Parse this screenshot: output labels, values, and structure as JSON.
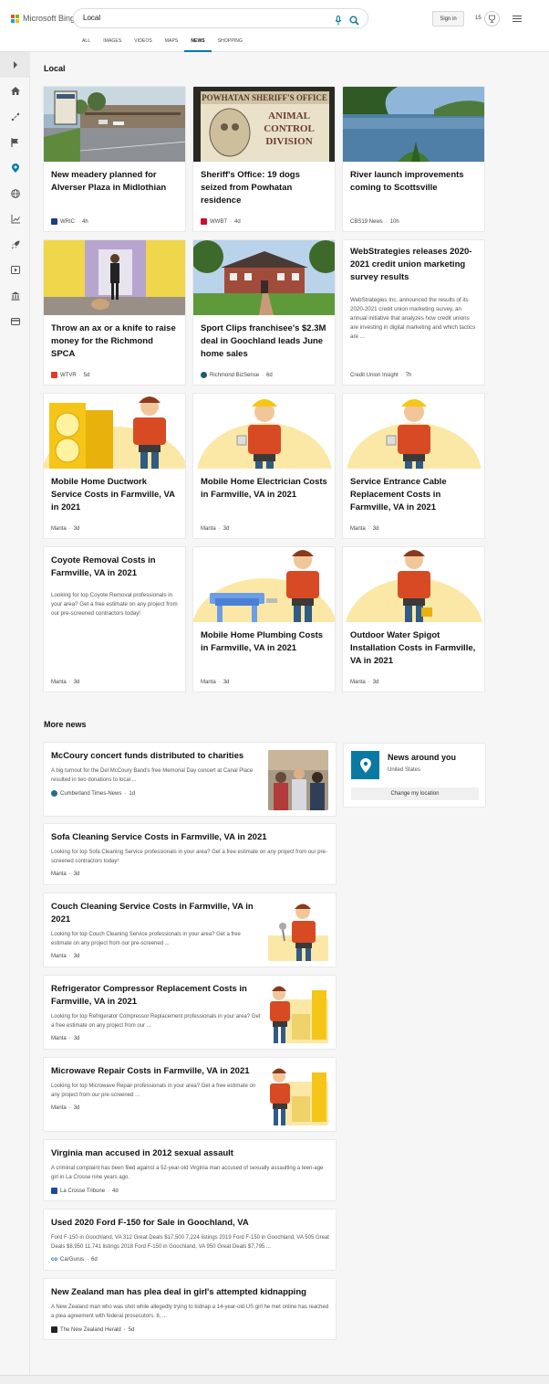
{
  "header": {
    "brand": "Microsoft Bing",
    "query": "Local",
    "sign_in": "Sign in",
    "rewards_count": "15",
    "tabs": [
      {
        "label": "ALL",
        "active": false
      },
      {
        "label": "IMAGES",
        "active": false
      },
      {
        "label": "VIDEOS",
        "active": false
      },
      {
        "label": "MAPS",
        "active": false
      },
      {
        "label": "NEWS",
        "active": true
      },
      {
        "label": "SHOPPING",
        "active": false
      }
    ]
  },
  "rail": {
    "icons": [
      "expand-icon",
      "home-icon",
      "topics-icon",
      "flag-icon",
      "location-icon",
      "globe-icon",
      "chart-icon",
      "rocket-icon",
      "play-icon",
      "bank-icon",
      "card-icon"
    ]
  },
  "local": {
    "title": "Local",
    "cards": [
      {
        "title": "New meadery planned for Alverser Plaza in Midlothian",
        "source": "WRIC",
        "age": "4h",
        "thumb": "plaza"
      },
      {
        "title": "Sheriff's Office: 19 dogs seized from Powhatan residence",
        "source": "WWBT",
        "age": "4d",
        "thumb": "sign"
      },
      {
        "title": "River launch improvements coming to Scottsville",
        "source": "CBS19 News",
        "age": "10h",
        "thumb": "river"
      },
      {
        "title": "Throw an ax or a knife to raise money for the Richmond SPCA",
        "source": "WTVR",
        "age": "5d",
        "thumb": "hallway"
      },
      {
        "title": "Sport Clips franchisee's $2.3M deal in Goochland leads June home sales",
        "source": "Richmond BizSense",
        "age": "6d",
        "thumb": "house"
      },
      {
        "title": "WebStrategies releases 2020-2021 credit union marketing survey results",
        "snippet": "WebStrategies Inc. announced the results of its 2020-2021 credit union marketing survey, an annual initiative that analyzes how credit unions are investing in digital marketing and which tactics are ...",
        "source": "Credit Union Insight",
        "age": "7h"
      },
      {
        "title": "Mobile Home Ductwork Service Costs in Farmville, VA in 2021",
        "source": "Manta",
        "age": "3d",
        "thumb": "manta-ac"
      },
      {
        "title": "Mobile Home Electrician Costs in Farmville, VA in 2021",
        "source": "Manta",
        "age": "3d",
        "thumb": "manta-hardhat"
      },
      {
        "title": "Service Entrance Cable Replacement Costs in Farmville, VA in 2021",
        "source": "Manta",
        "age": "3d",
        "thumb": "manta-hardhat"
      },
      {
        "title": "Coyote Removal Costs in Farmville, VA in 2021",
        "snippet": "Looking for top Coyote Removal professionals in your area? Get a free estimate on any project from our pre-screened contractors today!",
        "source": "Manta",
        "age": "3d"
      },
      {
        "title": "Mobile Home Plumbing Costs in Farmville, VA in 2021",
        "source": "Manta",
        "age": "3d",
        "thumb": "manta-sink"
      },
      {
        "title": "Outdoor Water Spigot Installation Costs in Farmville, VA in 2021",
        "source": "Manta",
        "age": "3d",
        "thumb": "manta-plain"
      }
    ]
  },
  "more_news": {
    "title": "More news",
    "items": [
      {
        "title": "McCoury concert funds distributed to charities",
        "snippet": "A big turnout for the Del McCoury Band's free Memorial Day concert at Canal Place resulted in two donations to local ...",
        "source": "Cumberland Times-News",
        "age": "1d"
      },
      {
        "title": "Sofa Cleaning Service Costs in Farmville, VA in 2021",
        "snippet": "Looking for top Sofa Cleaning Service professionals in your area? Get a free estimate on any project from our pre-screened contractors today!",
        "source": "Manta",
        "age": "3d"
      },
      {
        "title": "Couch Cleaning Service Costs in Farmville, VA in 2021",
        "snippet": "Looking for top Couch Cleaning Service professionals in your area? Get a free estimate on any project from our pre-screened ...",
        "source": "Manta",
        "age": "3d"
      },
      {
        "title": "Refrigerator Compressor Replacement Costs in Farmville, VA in 2021",
        "snippet": "Looking for top Refrigerator Compressor Replacement professionals in your area? Get a free estimate on any project from our ...",
        "source": "Manta",
        "age": "3d"
      },
      {
        "title": "Microwave Repair Costs in Farmville, VA in 2021",
        "snippet": "Looking for top Microwave Repair professionals in your area? Get a free estimate on any project from our pre-screened ...",
        "source": "Manta",
        "age": "3d"
      },
      {
        "title": "Virginia man accused in 2012 sexual assault",
        "snippet": "A criminal complaint has been filed against a 52-year-old Virginia man accused of sexually assaulting a teen-age girl in La Crosse nine years ago.",
        "source": "La Crosse Tribune",
        "age": "4d"
      },
      {
        "title": "Used 2020 Ford F-150 for Sale in Goochland, VA",
        "snippet": "Ford F-150 in Goochland, VA 312 Great Deals $17,500 7,224 listings 2019 Ford F-150 in Goochland, VA 505 Great Deals $8,950 11,741 listings 2018 Ford F-150 in Goochland, VA 950 Great Deals $7,795 ...",
        "source": "CarGurus",
        "age": "6d"
      },
      {
        "title": "New Zealand man has plea deal in girl's attempted kidnapping",
        "snippet": "A New Zealand man who was shot while allegedly trying to kidnap a 14-year-old US girl he met online has reached a plea agreement with federal prosecutors. 8, ...",
        "source": "The New Zealand Herald",
        "age": "5d"
      }
    ]
  },
  "news_around": {
    "title": "News around you",
    "country": "United States",
    "button": "Change my location"
  },
  "colors": {
    "accent": "#0078b6",
    "pin_bg": "#0a7aa3",
    "manta_sun": "#fbe8a6",
    "manta_shirt": "#d84a24"
  }
}
